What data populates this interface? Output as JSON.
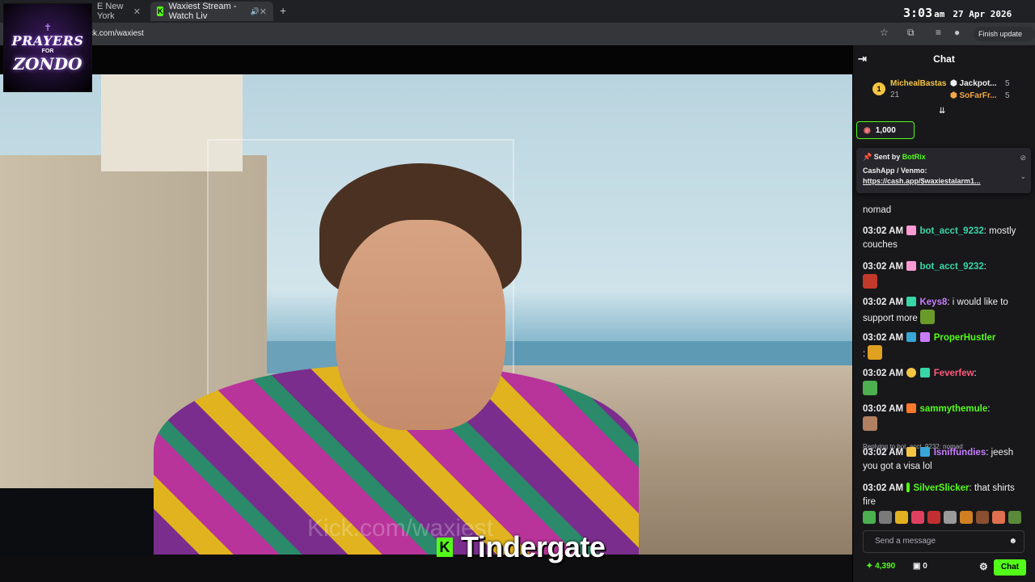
{
  "browser": {
    "tab1_title": "E New York",
    "tab2_title": "Waxiest Stream - Watch Liv",
    "url": "ck.com/waxiest",
    "finish_update": "Finish update"
  },
  "clock": {
    "time": "3:03",
    "ampm": "am",
    "date": "27 Apr 2026"
  },
  "logo": {
    "line1": "PRAYERS",
    "line2": "FOR",
    "line3": "ZONDO"
  },
  "video": {
    "caption": "Kick.com/waxiest",
    "overlay_title": "Tindergate"
  },
  "chat": {
    "header": "Chat",
    "leaderboard": [
      {
        "rank": "1",
        "name": "MichealBastas",
        "count": "21"
      },
      {
        "name": "Jackpot...",
        "count": "5"
      },
      {
        "name": "SoFarFr...",
        "count": "5"
      }
    ],
    "goal": "1,000",
    "pinned": {
      "sent_by": "Sent by",
      "bot": "BotRix",
      "line1": "CashApp / Venmo:",
      "line2": "https://cash.app/$waxiestalarm1..."
    },
    "messages": [
      {
        "ts": "03:02 AM",
        "user": "bot_acct_9232",
        "text": "nomad",
        "color": "#38d6a6"
      },
      {
        "ts": "03:02 AM",
        "user": "bot_acct_9232",
        "text": "mostly couches",
        "color": "#38d6a6"
      },
      {
        "ts": "03:02 AM",
        "user": "bot_acct_9232",
        "text": "",
        "color": "#38d6a6"
      },
      {
        "ts": "03:02 AM",
        "user": "Keys8",
        "text": "i would like to support more",
        "color": "#c77dff"
      },
      {
        "ts": "03:02 AM",
        "user": "ProperHustler",
        "text": "",
        "color": "#53fc18"
      },
      {
        "ts": "03:02 AM",
        "user": "Feverfew",
        "text": "",
        "color": "#ff5a7a"
      },
      {
        "ts": "03:02 AM",
        "user": "sammythemule",
        "text": "",
        "color": "#53fc18"
      },
      {
        "ts": "03:02 AM",
        "user": "Isniffundies",
        "text": "jeesh you got a visa lol",
        "color": "#c77dff"
      },
      {
        "ts": "03:02 AM",
        "user": "SilverSlicker",
        "text": "that shirts fire",
        "color": "#53fc18"
      }
    ],
    "reply_note": "Replying to bot_acct_9232: nomad",
    "composer_placeholder": "Send a message",
    "points": "4,390",
    "gifts": "0",
    "chat_button": "Chat"
  },
  "colors": {
    "accent": "#53fc18",
    "chat_bg": "#18181b"
  }
}
